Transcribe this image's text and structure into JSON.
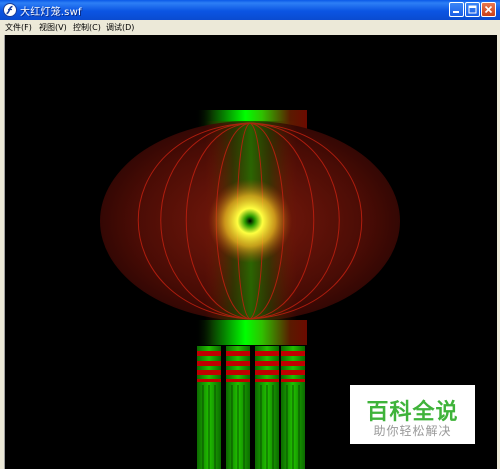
{
  "window": {
    "title": "大红灯笼.swf"
  },
  "menu": {
    "items": [
      "文件(F)",
      "视图(V)",
      "控制(C)",
      "调试(D)"
    ]
  },
  "content": {
    "description_icon": "lantern-graphic"
  },
  "watermark": {
    "title": "百科全说",
    "subtitle": "助你轻松解决"
  },
  "colors": {
    "titlebar": "#0b55e3",
    "stage": "#000000",
    "lantern_red": "#8b0000",
    "lantern_green": "#00e000",
    "watermark_green": "#3fb33a"
  }
}
